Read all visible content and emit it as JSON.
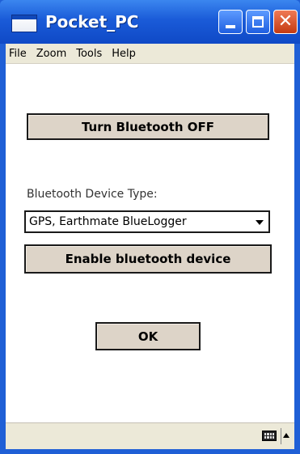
{
  "window": {
    "title": "Pocket_PC"
  },
  "menu": [
    "File",
    "Zoom",
    "Tools",
    "Help"
  ],
  "main": {
    "bluetooth_toggle_label": "Turn Bluetooth OFF",
    "device_type_label": "Bluetooth Device Type:",
    "device_type_selected": "GPS, Earthmate BlueLogger",
    "enable_device_label": "Enable bluetooth device",
    "ok_label": "OK"
  },
  "icons": {
    "app": "pocket-pc-app-icon",
    "minimize": "minimize-icon",
    "maximize": "maximize-icon",
    "close": "close-icon",
    "keyboard": "keyboard-icon",
    "sip_toggle": "chevron-up-icon"
  },
  "colors": {
    "titlebar": "#1a5bd8",
    "button_bg": "#ddd4c8",
    "menubar_bg": "#ece9d8",
    "close_button": "#c43a12"
  }
}
